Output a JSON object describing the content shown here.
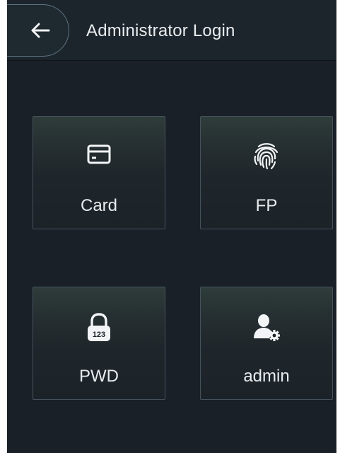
{
  "header": {
    "title": "Administrator Login",
    "back_icon": "arrow-left-icon"
  },
  "options": [
    {
      "label": "Card",
      "icon": "card-icon"
    },
    {
      "label": "FP",
      "icon": "fingerprint-icon"
    },
    {
      "label": "PWD",
      "icon": "padlock-123-icon",
      "icon_text": "123"
    },
    {
      "label": "admin",
      "icon": "user-gear-icon"
    }
  ],
  "colors": {
    "background": "#1a2027",
    "header": "#1d252c",
    "text": "#e8ecee",
    "tile_border": "#46525b"
  }
}
